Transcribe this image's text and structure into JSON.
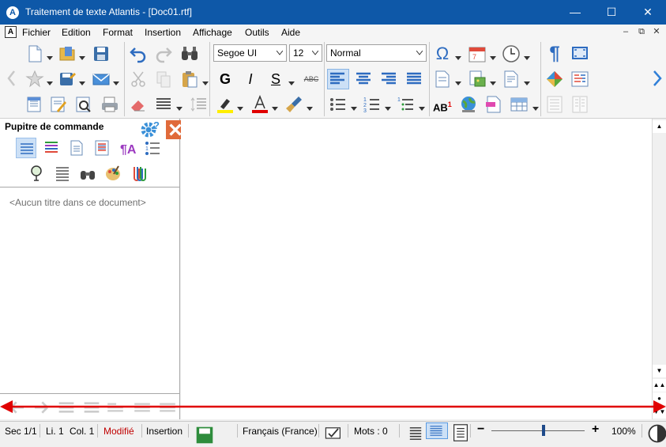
{
  "window": {
    "title": "Traitement de texte Atlantis - [Doc01.rtf]",
    "app_icon": "atlantis-logo",
    "controls": [
      "minimize",
      "maximize",
      "close"
    ]
  },
  "menu": {
    "items": [
      "Fichier",
      "Edition",
      "Format",
      "Insertion",
      "Affichage",
      "Outils",
      "Aide"
    ]
  },
  "toolbar": {
    "font_name": "Segoe UI",
    "font_size": "12",
    "style": "Normal",
    "bold": "G",
    "italic": "I",
    "underline": "S",
    "strikethrough": "ABC",
    "caps": "AB",
    "caps_sup": "1",
    "omega": "Ω",
    "pilcrow": "¶"
  },
  "panel": {
    "title": "Pupitre de commande",
    "empty_text": "<Aucun titre dans ce document>"
  },
  "status": {
    "section": "Sec 1/1",
    "line": "Li. 1",
    "column": "Col. 1",
    "modified": "Modifié",
    "insert_mode": "Insertion",
    "language": "Français (France)",
    "words": "Mots : 0",
    "zoom": "100%",
    "zoom_level": 0.56,
    "minus": "−",
    "plus": "+"
  },
  "colors": {
    "titlebar": "#0e58a8",
    "modified": "#c00000",
    "annotation_arrow": "#e00000"
  }
}
